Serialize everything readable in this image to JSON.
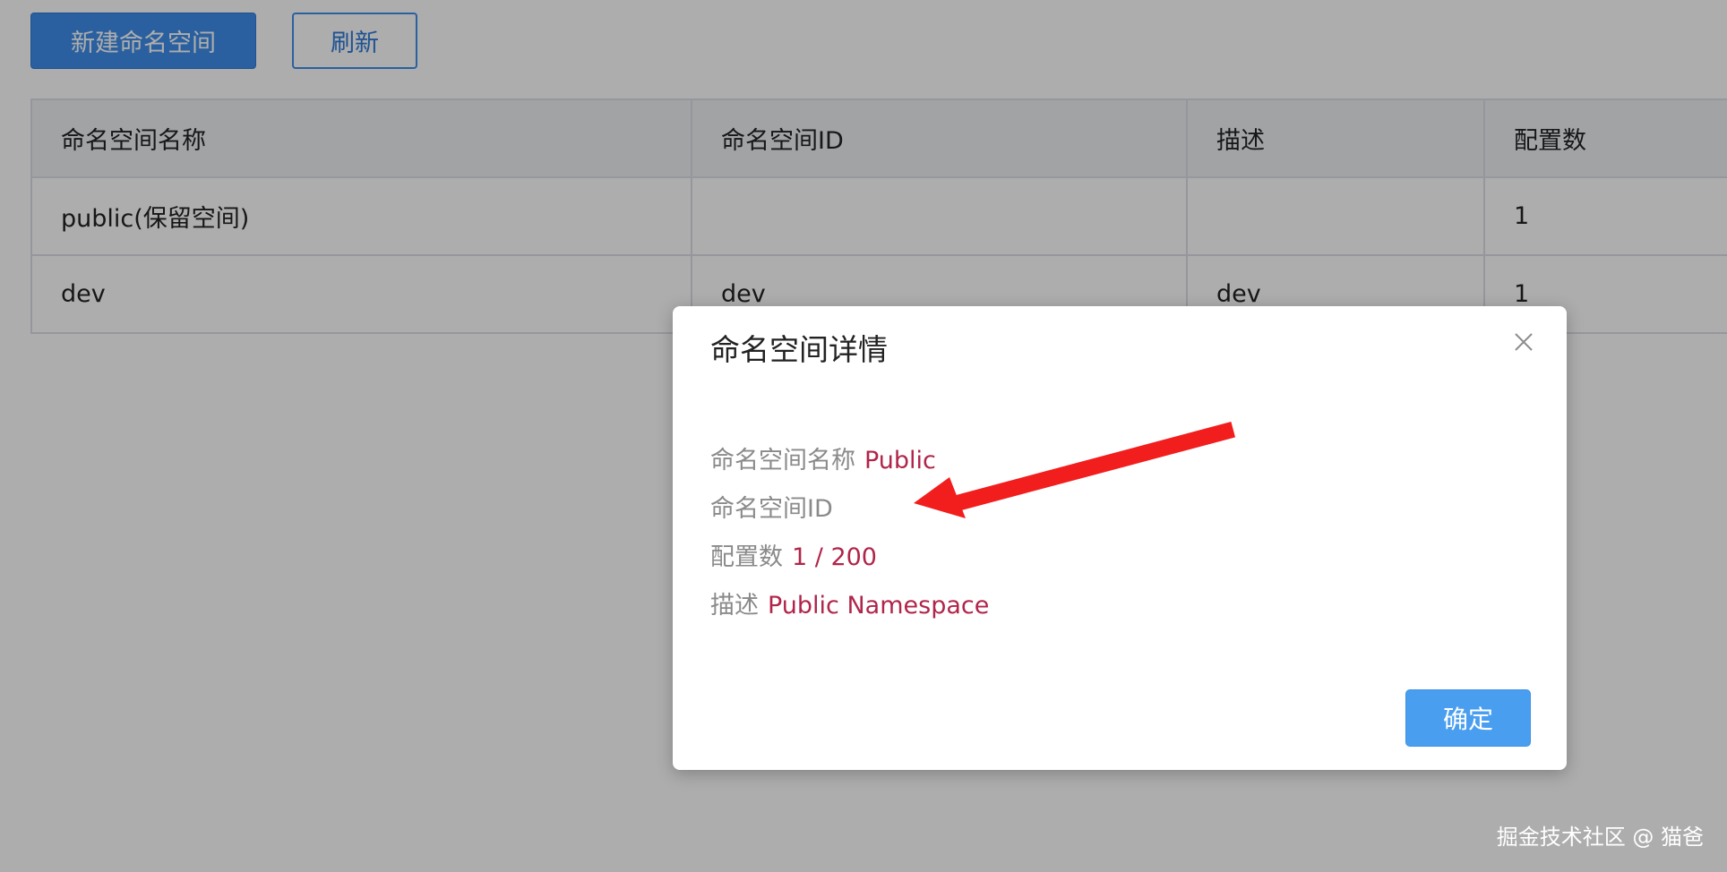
{
  "toolbar": {
    "create_label": "新建命名空间",
    "refresh_label": "刷新"
  },
  "table": {
    "headers": [
      "命名空间名称",
      "命名空间ID",
      "描述",
      "配置数"
    ],
    "rows": [
      [
        "public(保留空间)",
        "",
        "",
        "1"
      ],
      [
        "dev",
        "dev",
        "dev",
        "1"
      ]
    ]
  },
  "dialog": {
    "title": "命名空间详情",
    "name_label": "命名空间名称",
    "name_value": "Public",
    "id_label": "命名空间ID",
    "id_value": "",
    "config_label": "配置数",
    "config_value": "1 / 200",
    "desc_label": "描述",
    "desc_value": "Public Namespace",
    "confirm_label": "确定"
  },
  "watermark": "掘金技术社区 @ 猫爸",
  "colors": {
    "primary": "#3e8eea",
    "value_text": "#b0254a",
    "arrow": "#f21d1d"
  },
  "icons": {
    "close": "close-icon",
    "annotation": "arrow-icon"
  }
}
